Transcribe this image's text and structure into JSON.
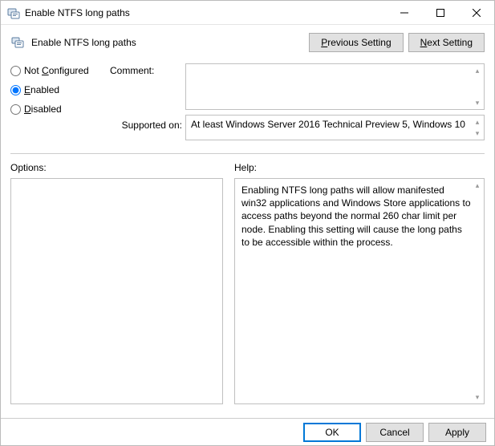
{
  "window": {
    "title": "Enable NTFS long paths"
  },
  "header": {
    "title": "Enable NTFS long paths",
    "prev_prefix": "P",
    "prev_rest": "revious Setting",
    "next_prefix": "N",
    "next_rest": "ext Setting"
  },
  "radios": {
    "not_configured_prefix": "C",
    "not_configured_label": "Not ",
    "not_configured_rest": "onfigured",
    "enabled_prefix": "E",
    "enabled_rest": "nabled",
    "disabled_prefix": "D",
    "disabled_rest": "isabled",
    "selected": "enabled"
  },
  "labels": {
    "comment": "Comment:",
    "supported_on": "Supported on:",
    "options": "Options:",
    "help": "Help:"
  },
  "fields": {
    "comment": "",
    "supported_on": "At least Windows Server 2016 Technical Preview 5, Windows 10",
    "options": "",
    "help": "Enabling NTFS long paths will allow manifested win32 applications and Windows Store applications to access paths beyond the normal 260 char limit per node.  Enabling this setting will cause the long paths to be accessible within the process."
  },
  "footer": {
    "ok": "OK",
    "cancel": "Cancel",
    "apply": "Apply"
  }
}
